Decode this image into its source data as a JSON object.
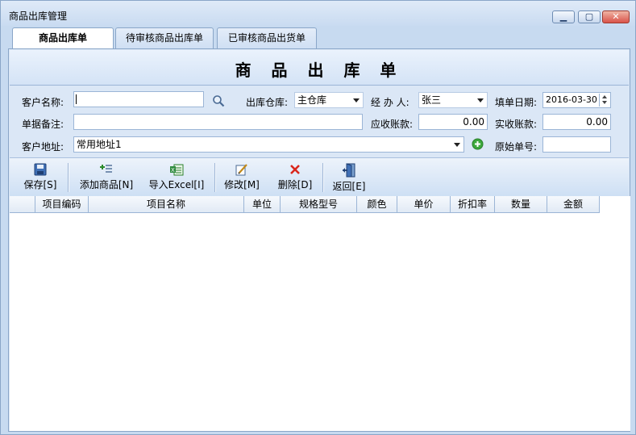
{
  "window": {
    "title": "商品出库管理",
    "minimize_glyph": "▁",
    "maximize_glyph": "▢",
    "close_glyph": "✕"
  },
  "tabs": [
    {
      "label": "商品出库单",
      "active": true
    },
    {
      "label": "待审核商品出库单",
      "active": false
    },
    {
      "label": "已审核商品出货单",
      "active": false
    }
  ],
  "form": {
    "heading": "商 品 出 库 单",
    "customer_name": {
      "label": "客户名称:",
      "value": ""
    },
    "warehouse": {
      "label": "出库仓库:",
      "value": "主仓库"
    },
    "handler": {
      "label": "经 办 人:",
      "value": "张三"
    },
    "fill_date": {
      "label": "填单日期:",
      "value": "2016-03-30"
    },
    "remark": {
      "label": "单据备注:",
      "value": ""
    },
    "receivable": {
      "label": "应收账款:",
      "value": "0.00"
    },
    "received": {
      "label": "实收账款:",
      "value": "0.00"
    },
    "address": {
      "label": "客户地址:",
      "value": "常用地址1"
    },
    "original_no": {
      "label": "原始单号:",
      "value": ""
    }
  },
  "toolbar": {
    "save": "保存[S]",
    "add_product": "添加商品[N]",
    "import_excel": "导入Excel[I]",
    "modify": "修改[M]",
    "delete": "删除[D]",
    "back": "返回[E]"
  },
  "table": {
    "columns": [
      "项目编码",
      "项目名称",
      "单位",
      "规格型号",
      "颜色",
      "单价",
      "折扣率",
      "数量",
      "金额"
    ],
    "rows": []
  },
  "icons": {
    "search": "search-icon",
    "add_address": "add-circle-icon",
    "save": "save-icon",
    "add_product": "add-product-icon",
    "import_excel": "excel-import-icon",
    "modify": "edit-icon",
    "delete": "delete-icon",
    "back": "exit-door-icon"
  },
  "colors": {
    "window_bg": "#c7daf0",
    "panel_bg": "#dbe7f6",
    "border": "#8aa6c8",
    "delete_red": "#d9261c",
    "add_green": "#3ca83c"
  }
}
